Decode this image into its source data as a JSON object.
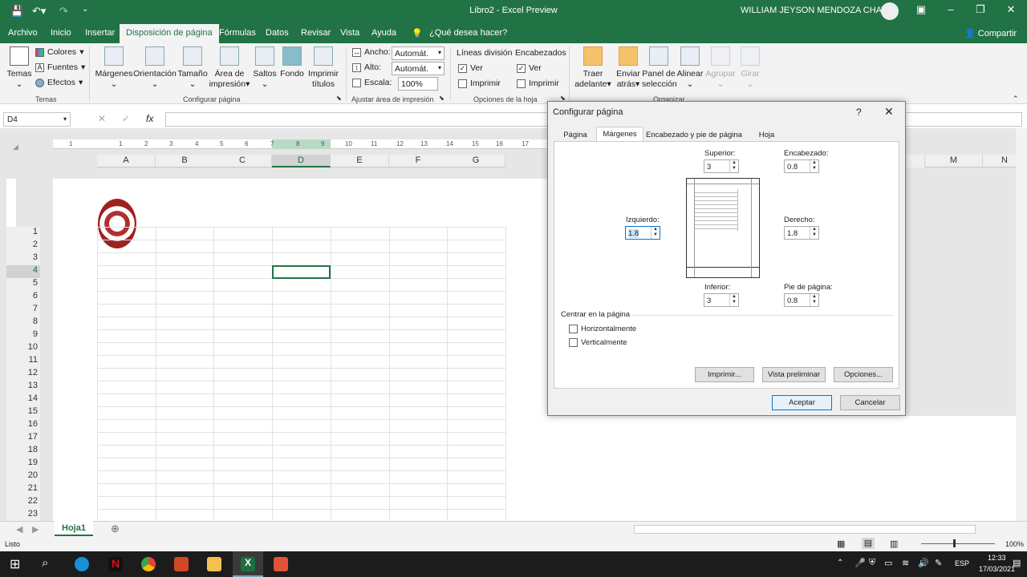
{
  "titlebar": {
    "title": "Libro2  -  Excel Preview",
    "user": "WILLIAM JEYSON MENDOZA CHAVEZ"
  },
  "tabs": [
    "Archivo",
    "Inicio",
    "Insertar",
    "Disposición de página",
    "Fórmulas",
    "Datos",
    "Revisar",
    "Vista",
    "Ayuda",
    "¿Qué desea hacer?"
  ],
  "share": "Compartir",
  "ribbon": {
    "temas": {
      "btn": "Temas",
      "colores": "Colores",
      "fuentes": "Fuentes",
      "efectos": "Efectos",
      "label": "Temas"
    },
    "config": {
      "margenes": "Márgenes",
      "orientacion": "Orientación",
      "tamano": "Tamaño",
      "area1": "Área de",
      "area2": "impresión",
      "saltos": "Saltos",
      "fondo": "Fondo",
      "imprimir1": "Imprimir",
      "imprimir2": "títulos",
      "label": "Configurar página"
    },
    "ajustar": {
      "ancho": "Ancho:",
      "ancho_val": "Automát.",
      "alto": "Alto:",
      "alto_val": "Automát.",
      "escala": "Escala:",
      "escala_val": "100%",
      "label": "Ajustar área de impresión"
    },
    "opciones": {
      "lineas": "Líneas división",
      "encab": "Encabezados",
      "ver1": "Ver",
      "imp1": "Imprimir",
      "ver2": "Ver",
      "imp2": "Imprimir",
      "label": "Opciones de la hoja"
    },
    "organizar": {
      "traer1": "Traer",
      "traer2": "adelante",
      "enviar1": "Enviar",
      "enviar2": "atrás",
      "panel1": "Panel de",
      "panel2": "selección",
      "alinear": "Alinear",
      "agrupar": "Agrupar",
      "girar": "Girar",
      "label": "Organizar"
    }
  },
  "formula": {
    "namebox": "D4",
    "fx": "fx"
  },
  "columns": [
    "A",
    "B",
    "C",
    "D",
    "E",
    "F",
    "G"
  ],
  "columns_right": [
    "M",
    "N"
  ],
  "rows": [
    "1",
    "2",
    "3",
    "4",
    "5",
    "6",
    "7",
    "8",
    "9",
    "10",
    "11",
    "12",
    "13",
    "14",
    "15",
    "16",
    "17",
    "18",
    "19",
    "20",
    "21",
    "22",
    "23"
  ],
  "ruler_nums": [
    "1",
    "1",
    "2",
    "3",
    "4",
    "5",
    "6",
    "7",
    "8",
    "9",
    "10",
    "11",
    "12",
    "13",
    "14",
    "15",
    "16",
    "17"
  ],
  "sheet_tab": "Hoja1",
  "status": {
    "left": "Listo",
    "zoom": "100%"
  },
  "taskbar": {
    "lang": "ESP",
    "time": "12:33",
    "date": "17/03/2021"
  },
  "dialog": {
    "title": "Configurar página",
    "help": "?",
    "tabs": [
      "Página",
      "Márgenes",
      "Encabezado y pie de página",
      "Hoja"
    ],
    "superior": "Superior:",
    "superior_val": "3",
    "encabezado": "Encabezado:",
    "encabezado_val": "0.8",
    "izquierdo": "Izquierdo:",
    "izquierdo_val": "1.8",
    "derecho": "Derecho:",
    "derecho_val": "1.8",
    "inferior": "Inferior:",
    "inferior_val": "3",
    "pie": "Pie de página:",
    "pie_val": "0.8",
    "centrar": "Centrar en la página",
    "horiz": "Horizontalmente",
    "vert": "Verticalmente",
    "imprimir": "Imprimir...",
    "vista": "Vista preliminar",
    "opciones": "Opciones...",
    "aceptar": "Aceptar",
    "cancelar": "Cancelar"
  }
}
